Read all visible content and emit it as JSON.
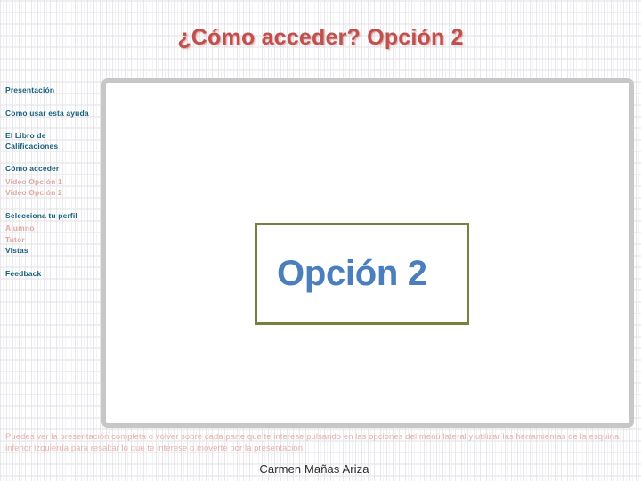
{
  "slide": {
    "title": "¿Cómo acceder? Opción 2",
    "title_color": "#c0504d",
    "background_color": "#ffffff"
  },
  "sidebar": {
    "items": [
      {
        "label": "Presentación",
        "level": "main"
      },
      {
        "label": "Como usar esta ayuda",
        "level": "main"
      },
      {
        "label": "El Libro de Calificaciones",
        "level": "main"
      },
      {
        "label": "Cómo acceder",
        "level": "main"
      },
      {
        "label": "Video Opción 1",
        "level": "sub"
      },
      {
        "label": "Video Opción 2",
        "level": "sub"
      },
      {
        "label": "Selecciona tu perfil",
        "level": "main"
      },
      {
        "label": "Alumno",
        "level": "sub"
      },
      {
        "label": "Tutor",
        "level": "sub"
      },
      {
        "label": "Vistas",
        "level": "main"
      },
      {
        "label": "Feedback",
        "level": "main"
      }
    ],
    "main_color": "#17607d",
    "sub_color": "#dfa8a4"
  },
  "content": {
    "option_box": {
      "label": "Opción 2",
      "border_color": "#74823f",
      "text_color": "#4a7ebc"
    },
    "panel_border_color": "#c7c7c7"
  },
  "footer": {
    "note": "Puedes ver la presentación completa o volver sobre cada parte que te interese pulsando en las opciones del menú lateral y utilizar las herramientas de la esquina inferior izquierda para resaltar lo que te interese o moverte por la presentación.",
    "note_color": "#e3b2ae",
    "author": "Carmen Mañas Ariza"
  }
}
